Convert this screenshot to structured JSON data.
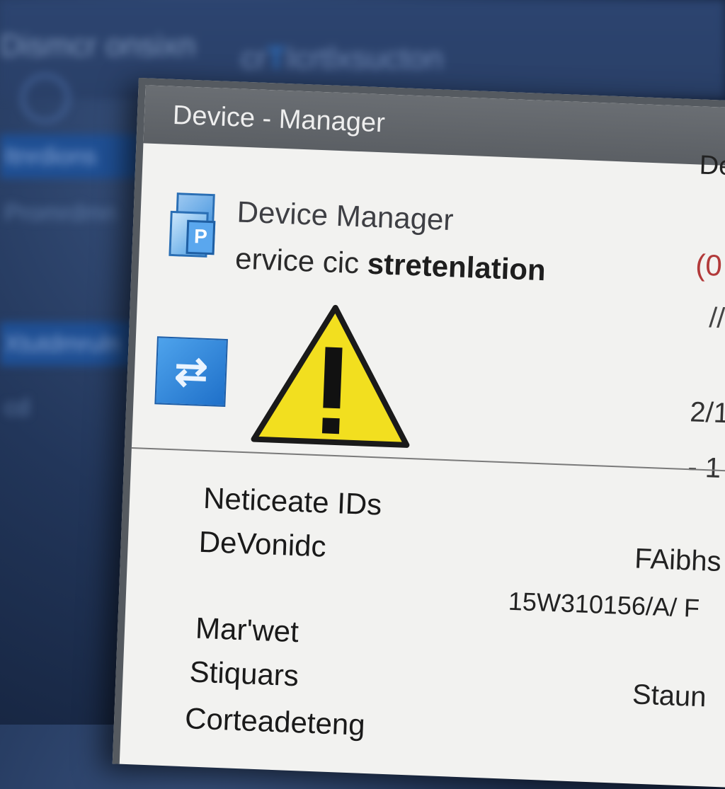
{
  "background": {
    "title_left": "Dismcr onsixn",
    "title_right_a": "cr",
    "title_right_hl": "T",
    "title_right_b": "Icrtlxsucton",
    "sidebar_items": [
      "Itnrdions",
      "Promrdmn",
      "Xtutdmruln",
      "cd"
    ]
  },
  "window": {
    "title": "Device - Manager",
    "title_right": "De",
    "heading": "Device Manager",
    "subheading_normal": "ervice cic ",
    "subheading_bold": "stretenlation",
    "right_top": "(0",
    "right_slash": "//",
    "right_date": "2/1",
    "right_dash": "- 1",
    "fields": {
      "f1": "Neticeate IDs",
      "f2": "DeVonidc",
      "f3": "Mar'wet",
      "f4": "Stiquars",
      "f5": "Corteadeteng"
    },
    "values": {
      "v1": "FAibhs",
      "v2": "15W310156/A/ F",
      "v3": "Staun"
    }
  },
  "icons": {
    "app": "device-manager-icon",
    "network": "network-adapter-icon",
    "warning": "warning-icon"
  },
  "colors": {
    "warning_fill": "#f2df1f",
    "accent": "#2d7dd8",
    "status_red": "#b23a3a"
  }
}
